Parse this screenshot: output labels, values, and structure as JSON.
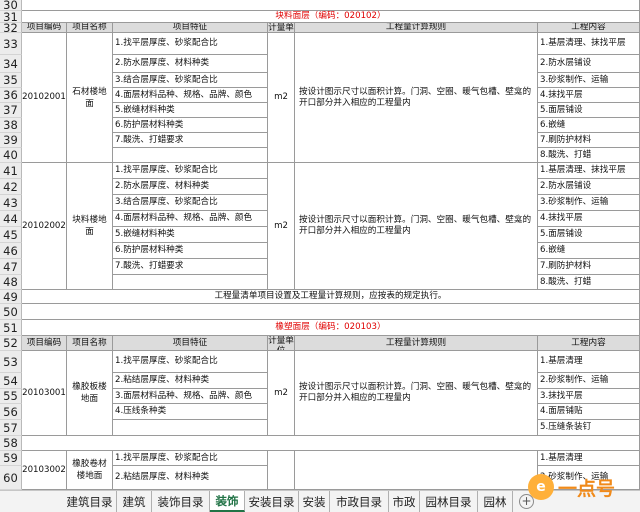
{
  "sheet": {
    "row_numbers": [
      "30",
      "31",
      "32",
      "33",
      "34",
      "35",
      "36",
      "37",
      "38",
      "39",
      "40",
      "41",
      "42",
      "43",
      "44",
      "45",
      "46",
      "47",
      "48",
      "49",
      "50",
      "51",
      "52",
      "53",
      "54",
      "55",
      "56",
      "57",
      "58",
      "59",
      "60"
    ],
    "section1_title": "块料面层（编码：020102）",
    "section2_title": "橡塑面层（编码：020103）",
    "headers": {
      "code": "项目编码",
      "name": "项目名称",
      "features": "项目特征",
      "unit": "计量单位",
      "rule": "工程量计算规则",
      "content": "工程内容"
    },
    "blocks": [
      {
        "code": "20102001",
        "name": "石材楼地面",
        "unit": "m2",
        "rule": "按设计图示尺寸以面积计算。门洞、空圈、暖气包槽、壁龛的开口部分并入相应的工程量内",
        "features": [
          "1.找平层厚度、砂浆配合比",
          "2.防水层厚度、材料种类",
          "3.结合层厚度、砂浆配合比",
          "4.面层材料品种、规格、品牌、颜色",
          "5.嵌缝材料种类",
          "6.防护层材料种类",
          "7.酸洗、打蜡要求",
          ""
        ],
        "contents": [
          "1.基层清理、抹找平层",
          "2.防水层铺设",
          "3.砂浆制作、运输",
          "4.抹找平层",
          "5.面层铺设",
          "6.嵌缝",
          "7.刷防护材料",
          "8.酸洗、打蜡"
        ]
      },
      {
        "code": "20102002",
        "name": "块料楼地面",
        "unit": "m2",
        "rule": "按设计图示尺寸以面积计算。门洞、空圈、暖气包槽、壁龛的开口部分并入相应的工程量内",
        "features": [
          "1.找平层厚度、砂浆配合比",
          "2.防水层厚度、材料种类",
          "3.结合层厚度、砂浆配合比",
          "4.面层材料品种、规格、品牌、颜色",
          "5.嵌缝材料种类",
          "6.防护层材料种类",
          "7.酸洗、打蜡要求",
          ""
        ],
        "contents": [
          "1.基层清理、抹找平层",
          "2.防水层铺设",
          "3.砂浆制作、运输",
          "4.抹找平层",
          "5.面层铺设",
          "6.嵌缝",
          "7.刷防护材料",
          "8.酸洗、打蜡"
        ]
      }
    ],
    "note": "工程量清单项目设置及工程量计算规则，应按表的规定执行。",
    "block3": {
      "code": "20103001",
      "name": "橡胶板楼地面",
      "unit": "m2",
      "rule": "按设计图示尺寸以面积计算。门洞、空圈、暖气包槽、壁龛的开口部分并入相应的工程量内",
      "features": [
        "1.找平层厚度、砂浆配合比",
        "2.粘结层厚度、材料种类",
        "3.面层材料品种、规格、品牌、颜色",
        "4.压线条种类",
        ""
      ],
      "contents": [
        "1.基层清理",
        "2.砂浆制作、运输",
        "3.抹找平层",
        "4.面层铺贴",
        "5.压缝条装钉"
      ]
    },
    "block4": {
      "code": "20103002",
      "name": "橡胶卷材楼地面",
      "features": [
        "1.找平层厚度、砂浆配合比",
        "2.粘结层厚度、材料种类",
        "3.面层材料品种、规格、品牌、颜色"
      ],
      "contents": [
        "1.基层清理",
        "2.砂浆制作、运输",
        ""
      ]
    }
  },
  "tabs": [
    "建筑目录",
    "建筑",
    "装饰目录",
    "装饰",
    "安装目录",
    "安装",
    "市政目录",
    "市政",
    "园林目录",
    "园林"
  ],
  "active_tab": "装饰",
  "add_tab_label": "+",
  "watermark": {
    "logo": "e",
    "text": "一点号"
  }
}
